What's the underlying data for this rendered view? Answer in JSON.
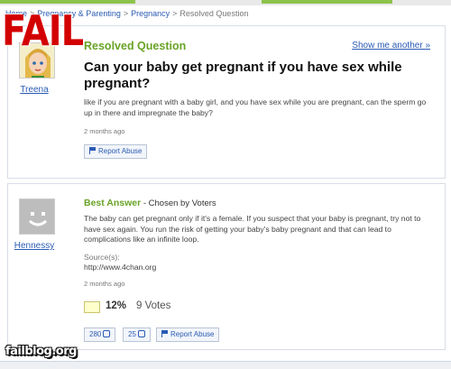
{
  "breadcrumb": {
    "items": [
      "Home",
      "Pregnancy & Parenting",
      "Pregnancy"
    ],
    "current": "Resolved Question"
  },
  "overlay": {
    "fail_text": "FAIL",
    "watermark": "failblog.org"
  },
  "question": {
    "username": "Treena",
    "status": "Resolved Question",
    "show_me_link": "Show me another »",
    "title": "Can your baby get pregnant if you have sex while pregnant?",
    "body": "like if you are pregnant with a baby girl, and you have sex while you are pregnant, can the sperm go up in there and impregnate the baby?",
    "time_ago": "2 months ago",
    "report_label": "Report Abuse"
  },
  "answer": {
    "username": "Hennessy",
    "best_label": "Best Answer",
    "chosen_by": " - Chosen by Voters",
    "body": "The baby can get pregnant only if it's a female. If you suspect that your baby is pregnant, try not to have sex again. You run the risk of getting your baby's baby pregnant and that can lead to complications like an infinite loop.",
    "sources_label": "Source(s):",
    "source_url": "http://www.4chan.org",
    "time_ago": "2 months ago",
    "vote_percent": "12%",
    "vote_count": "9 Votes",
    "thumbs_up": "280",
    "thumbs_down": "25",
    "report_label": "Report Abuse"
  },
  "colors": {
    "accent_green": "#69a326",
    "link_blue": "#2a5bb4",
    "fail_red": "#d30000"
  }
}
